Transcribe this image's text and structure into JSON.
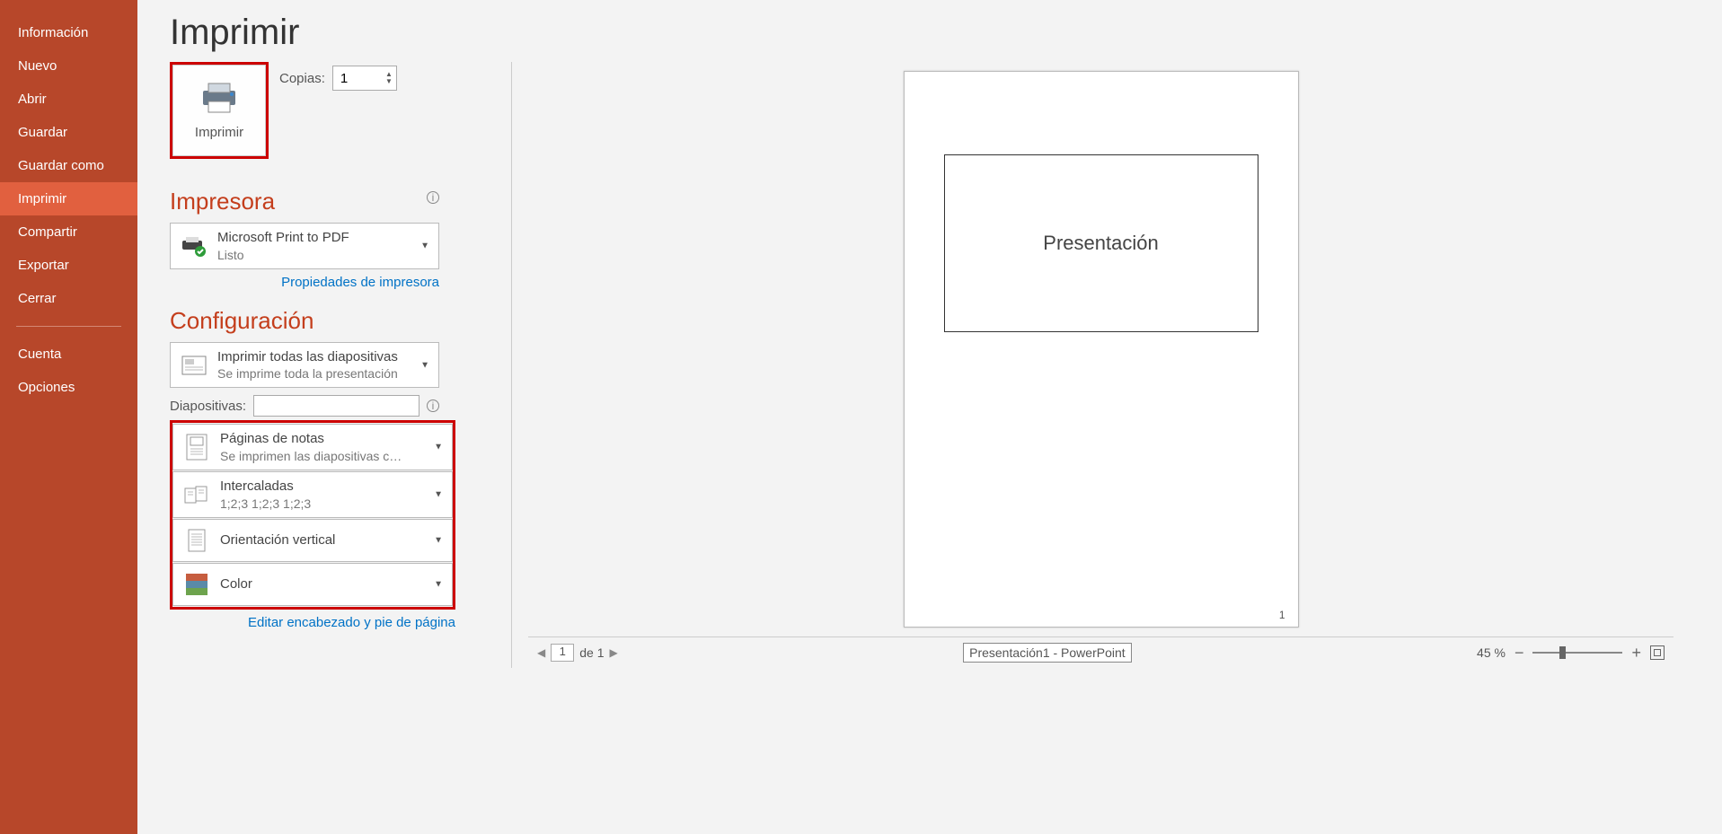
{
  "sidebar": {
    "items": [
      "Información",
      "Nuevo",
      "Abrir",
      "Guardar",
      "Guardar como",
      "Imprimir",
      "Compartir",
      "Exportar",
      "Cerrar"
    ],
    "items2": [
      "Cuenta",
      "Opciones"
    ],
    "active_index": 5
  },
  "page": {
    "title": "Imprimir"
  },
  "print": {
    "button_label": "Imprimir",
    "copies_label": "Copias:",
    "copies_value": "1"
  },
  "printer": {
    "section": "Impresora",
    "name": "Microsoft Print to PDF",
    "status": "Listo",
    "properties_link": "Propiedades de impresora"
  },
  "config": {
    "section": "Configuración",
    "what_print": {
      "title": "Imprimir todas las diapositivas",
      "sub": "Se imprime toda la presentación"
    },
    "slides_label": "Diapositivas:",
    "layout": {
      "title": "Páginas de notas",
      "sub": "Se imprimen las diapositivas con..."
    },
    "collation": {
      "title": "Intercaladas",
      "sub": "1;2;3    1;2;3    1;2;3"
    },
    "orientation": {
      "title": "Orientación vertical"
    },
    "color": {
      "title": "Color"
    },
    "edit_header_footer": "Editar encabezado y pie de página"
  },
  "preview": {
    "slide_title": "Presentación",
    "page_number": "1"
  },
  "pager": {
    "current": "1",
    "of_label": "de 1",
    "doc_title": "Presentación1 - PowerPoint",
    "zoom_percent": "45 %"
  }
}
